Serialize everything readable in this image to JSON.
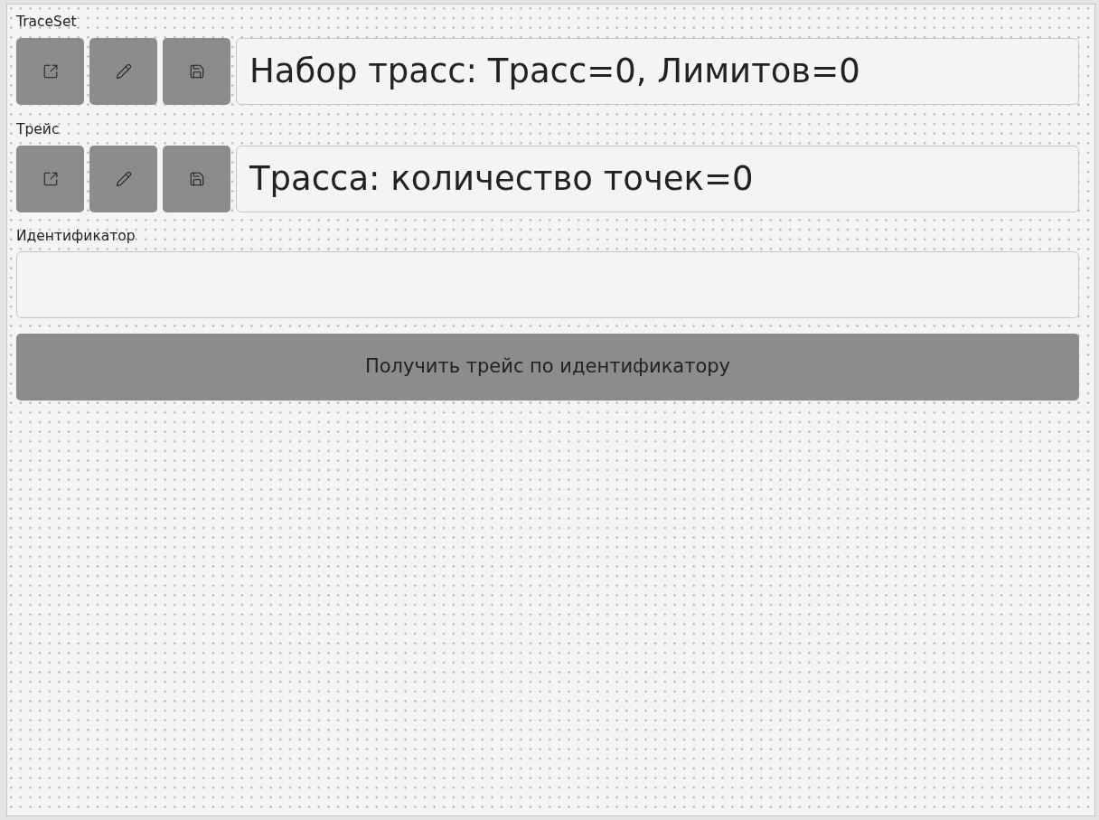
{
  "trace_set": {
    "label": "TraceSet",
    "summary": "Набор трасс: Трасс=0, Лимитов=0"
  },
  "trace": {
    "label": "Трейс",
    "summary": "Трасса: количество точек=0"
  },
  "identifier": {
    "label": "Идентификатор"
  },
  "fetch_button": {
    "label": "Получить трейс по идентификатору"
  }
}
